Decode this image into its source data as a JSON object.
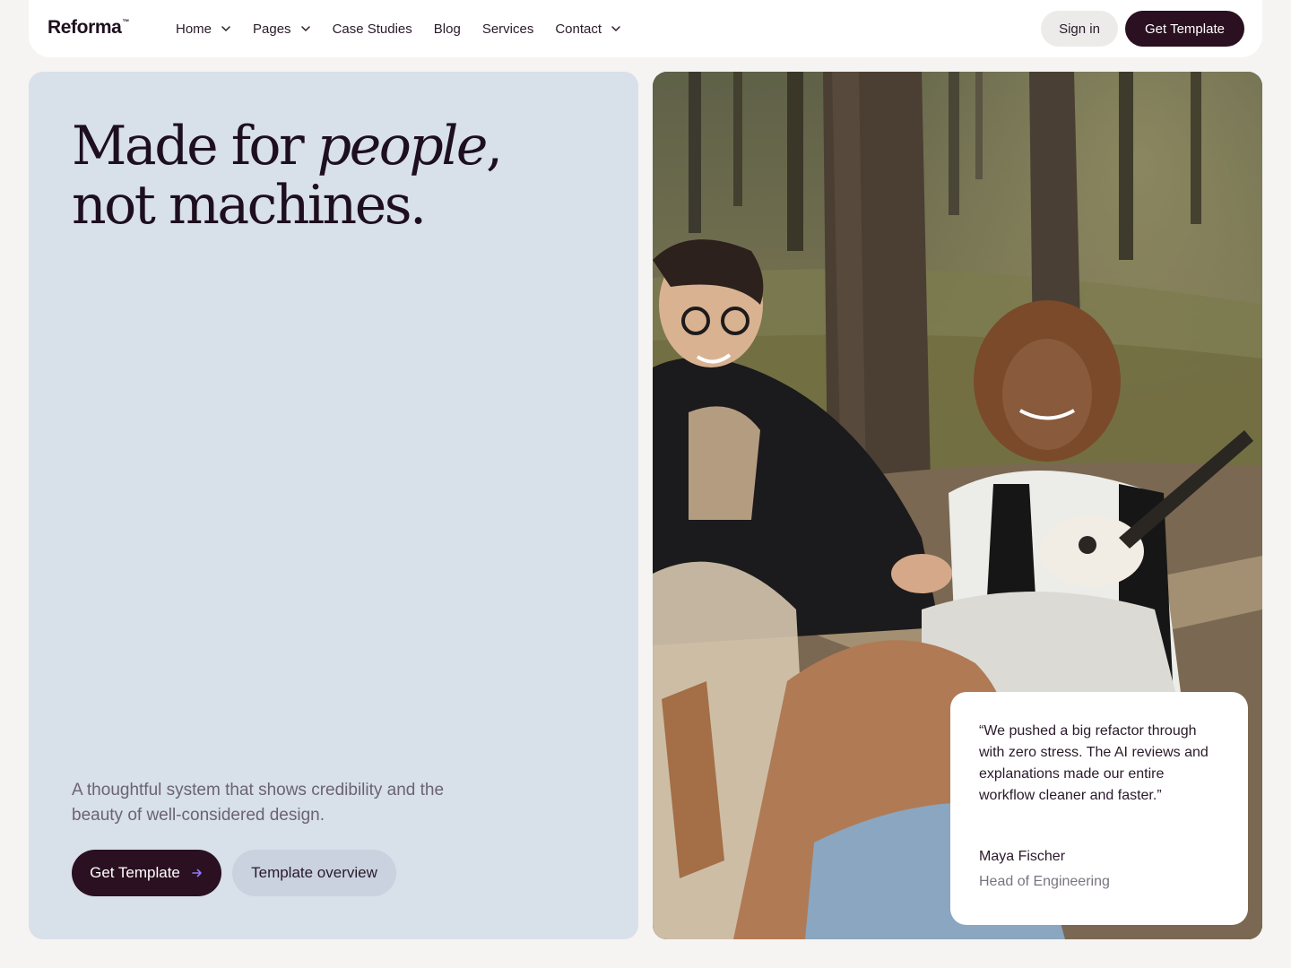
{
  "brand": {
    "name": "Reforma",
    "tm": "™"
  },
  "nav": {
    "items": [
      {
        "label": "Home",
        "dropdown": true
      },
      {
        "label": "Pages",
        "dropdown": true
      },
      {
        "label": "Case Studies",
        "dropdown": false
      },
      {
        "label": "Blog",
        "dropdown": false
      },
      {
        "label": "Services",
        "dropdown": false
      },
      {
        "label": "Contact",
        "dropdown": true
      }
    ],
    "signin": "Sign in",
    "cta": "Get Template"
  },
  "hero": {
    "headline_line1_a": "Made for ",
    "headline_line1_em": "people",
    "headline_line1_b": ",",
    "headline_line2": "not machines.",
    "subtitle": "A thoughtful system that shows credibility and the beauty of well-considered design.",
    "primary_button": "Get Template",
    "primary_icon": "arrow-right-icon",
    "secondary_button": "Template overview"
  },
  "testimonial": {
    "quote": "“We pushed a big refactor through with zero stress. The AI reviews and explanations made our entire workflow cleaner and faster.”",
    "name": "Maya Fischer",
    "role": "Head of Engineering"
  },
  "colors": {
    "dark": "#2a1020",
    "panel": "#d8e0ea",
    "accent_arrow": "#8b7cf6",
    "background": "#f5f4f2"
  }
}
